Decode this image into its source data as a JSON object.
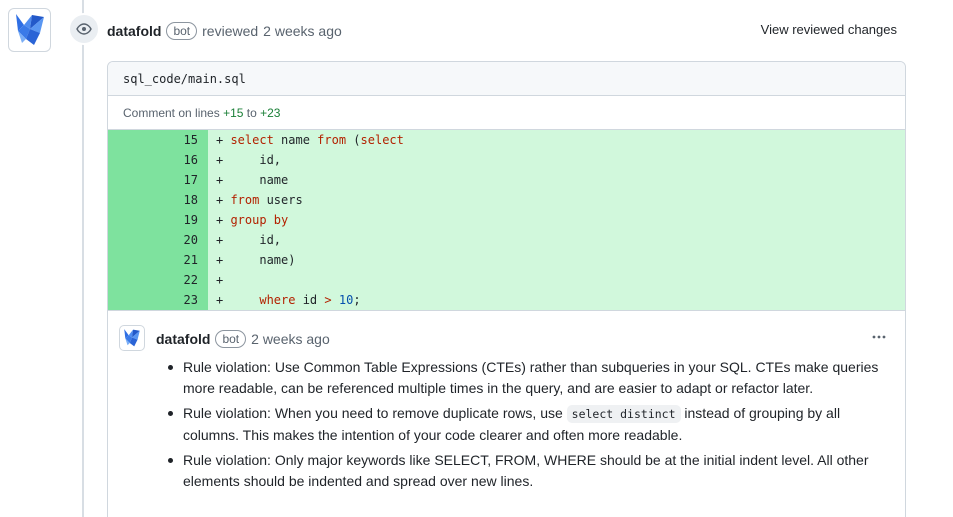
{
  "review": {
    "author": "datafold",
    "bot_label": "bot",
    "action": "reviewed",
    "time": "2 weeks ago",
    "view_changes_label": "View reviewed changes"
  },
  "file": {
    "path": "sql_code/main.sql",
    "comment_on_prefix": "Comment on lines",
    "start_line": "+15",
    "to_word": "to",
    "end_line": "+23"
  },
  "diff_lines": [
    {
      "num": "15",
      "sign": "+",
      "code": "select name from (select"
    },
    {
      "num": "16",
      "sign": "+",
      "code": "    id,"
    },
    {
      "num": "17",
      "sign": "+",
      "code": "    name"
    },
    {
      "num": "18",
      "sign": "+",
      "code": "from users"
    },
    {
      "num": "19",
      "sign": "+",
      "code": "group by"
    },
    {
      "num": "20",
      "sign": "+",
      "code": "    id,"
    },
    {
      "num": "21",
      "sign": "+",
      "code": "    name)"
    },
    {
      "num": "22",
      "sign": "+",
      "code": ""
    },
    {
      "num": "23",
      "sign": "+",
      "code": "    where id > 10;"
    }
  ],
  "comment": {
    "author": "datafold",
    "bot_label": "bot",
    "time": "2 weeks ago",
    "more_icon": "kebab-horizontal-icon",
    "items": [
      {
        "before": "Rule violation: Use Common Table Expressions (CTEs) rather than subqueries in your SQL. CTEs make queries more readable, can be referenced multiple times in the query, and are easier to adapt or refactor later.",
        "code": "",
        "after": ""
      },
      {
        "before": "Rule violation: When you need to remove duplicate rows, use ",
        "code": "select distinct",
        "after": " instead of grouping by all columns. This makes the intention of your code clearer and often more readable."
      },
      {
        "before": "Rule violation: Only major keywords like SELECT, FROM, WHERE should be at the initial indent level. All other elements should be indented and spread over new lines.",
        "code": "",
        "after": ""
      }
    ]
  },
  "colors": {
    "added_line_number_bg": "#7ee29e",
    "added_line_bg": "#d1f8dc",
    "keyword": "#b32100",
    "number": "#0550ae",
    "logo_blue": "#2f6fe4"
  }
}
